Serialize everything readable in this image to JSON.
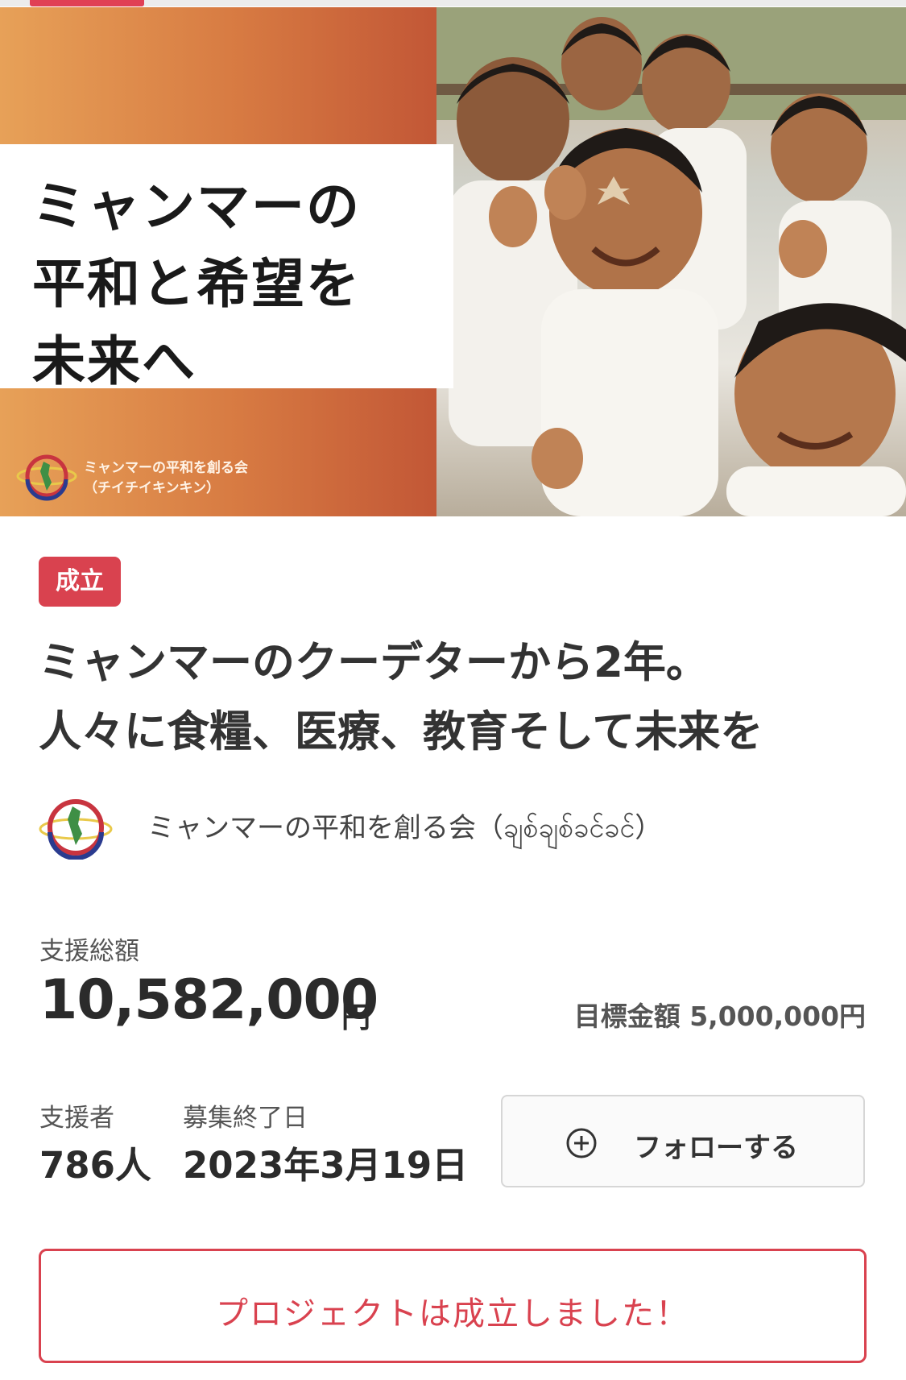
{
  "hero": {
    "title_lines": [
      "ミャンマーの",
      "平和と希望を",
      "未来へ"
    ],
    "org_line1": "ミャンマーの平和を創る会",
    "org_line2": "（チイチイキンキン）"
  },
  "project": {
    "status_badge": "成立",
    "title_line1": "ミャンマーのクーデターから2年。",
    "title_line2": "人々に食糧、医療、教育そして未来を",
    "owner_name": "ミャンマーの平和を創る会（ချစ်ချစ်ခင်ခင်）"
  },
  "stats": {
    "total_label": "支援総額",
    "total_amount": "10,582,000",
    "total_unit": "円",
    "goal_text": "目標金額 5,000,000円",
    "supporters_label": "支援者",
    "supporters_value": "786人",
    "end_date_label": "募集終了日",
    "end_date_value": "2023年3月19日"
  },
  "actions": {
    "follow_label": "フォローする",
    "success_label": "プロジェクトは成立しました！"
  },
  "colors": {
    "accent": "#d9424f",
    "banner_gradient_start": "#e7a158",
    "banner_gradient_end": "#c25736"
  },
  "icons": {
    "follow": "plus-circle-icon",
    "logo": "myanmar-map-globe-logo"
  }
}
